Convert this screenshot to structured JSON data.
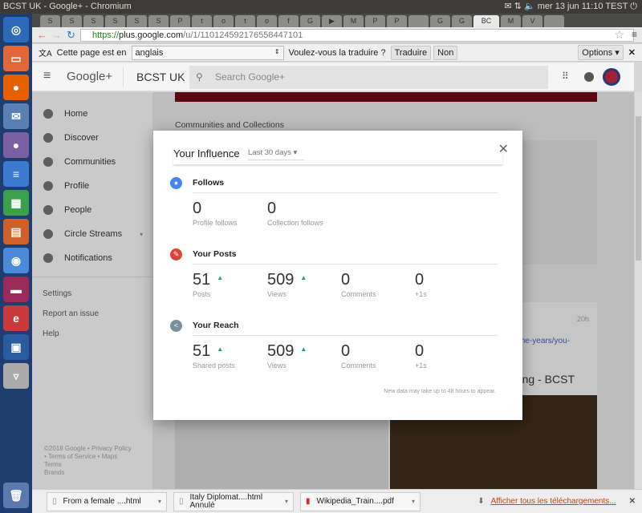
{
  "window": {
    "title": "BCST UK - Google+ - Chromium",
    "tray": {
      "date": "mer 13 jun 11:10",
      "user": "TEST"
    }
  },
  "tabs": [
    "S",
    "S",
    "S",
    "S",
    "S",
    "S",
    "P",
    "t",
    "o",
    "t",
    "o",
    "f",
    "G",
    "▶",
    "M",
    "P",
    "P",
    "",
    "G",
    "G",
    "BC",
    "M",
    "V",
    ""
  ],
  "browser": {
    "url_scheme": "https://",
    "url_host": "plus.google.com",
    "url_path": "/u/1/110124592176558447101"
  },
  "translate": {
    "prefix": "Cette page est en",
    "language": "anglais",
    "question": "Voulez-vous la traduire ?",
    "translate_btn": "Traduire",
    "no_btn": "Non",
    "options": "Options"
  },
  "header": {
    "brand": "Google+",
    "page": "BCST UK",
    "search_placeholder": "Search Google+"
  },
  "sidebar": {
    "items": [
      {
        "label": "Home"
      },
      {
        "label": "Discover"
      },
      {
        "label": "Communities"
      },
      {
        "label": "Profile"
      },
      {
        "label": "People"
      },
      {
        "label": "Circle Streams"
      },
      {
        "label": "Notifications"
      }
    ],
    "links": [
      "Settings",
      "Report an issue",
      "Help"
    ],
    "footer": [
      "©2018 Google • Privacy Policy",
      "• Terms of Service • Maps",
      "Terms",
      "Brands"
    ]
  },
  "main": {
    "section_title": "Communities and Collections",
    "post_time": "20h",
    "post_link": "-the-years/you-",
    "post_title": "ng - BCST"
  },
  "modal": {
    "title": "Your Influence",
    "period": "Last 30 days",
    "footnote": "New data may take up to 48 hours to appear.",
    "sections": [
      {
        "title": "Follows",
        "icon": "person-icon",
        "color": "#4285f4",
        "stats": [
          {
            "value": "0",
            "label": "Profile follows"
          },
          {
            "value": "0",
            "label": "Collection follows"
          }
        ]
      },
      {
        "title": "Your Posts",
        "icon": "pencil-icon",
        "color": "#db4437",
        "stats": [
          {
            "value": "51",
            "label": "Posts",
            "trend": "up"
          },
          {
            "value": "509",
            "label": "Views",
            "trend": "up"
          },
          {
            "value": "0",
            "label": "Comments"
          },
          {
            "value": "0",
            "label": "+1s"
          }
        ]
      },
      {
        "title": "Your Reach",
        "icon": "share-icon",
        "color": "#78909c",
        "stats": [
          {
            "value": "51",
            "label": "Shared posts",
            "trend": "up"
          },
          {
            "value": "509",
            "label": "Views",
            "trend": "up"
          },
          {
            "value": "0",
            "label": "Comments"
          },
          {
            "value": "0",
            "label": "+1s"
          }
        ]
      }
    ]
  },
  "downloads": {
    "items": [
      {
        "name": "From a female ....html"
      },
      {
        "name": "Italy  Diplomat....html",
        "status": "Annulé"
      },
      {
        "name": "Wikipedia_Train....pdf"
      }
    ],
    "show_all": "Afficher tous les téléchargements..."
  }
}
